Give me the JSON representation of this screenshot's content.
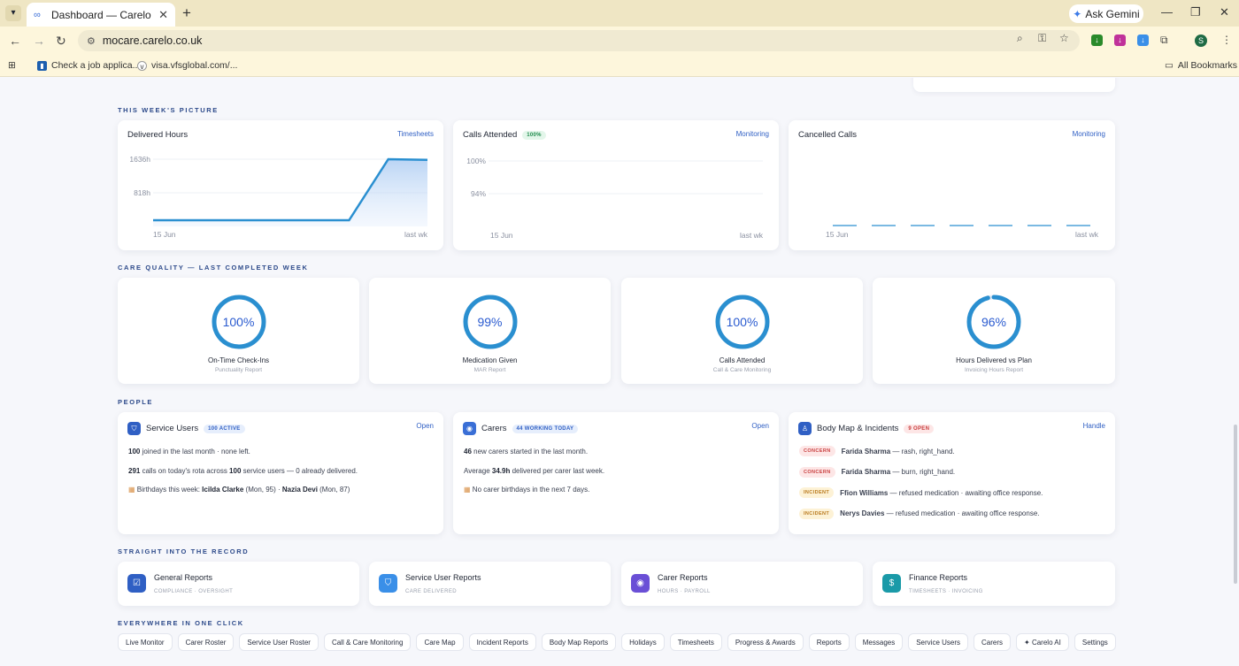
{
  "browser": {
    "tab_title": "Dashboard — Carelo",
    "url": "mocare.carelo.co.uk",
    "ask_gemini": "Ask Gemini",
    "profile_initial": "S",
    "bookmarks": [
      "Check a job applica...",
      "visa.vfsglobal.com/..."
    ],
    "all_bookmarks": "All Bookmarks"
  },
  "sections": {
    "week": "THIS WEEK'S PICTURE",
    "quality": "CARE QUALITY — LAST COMPLETED WEEK",
    "people": "PEOPLE",
    "record": "STRAIGHT INTO THE RECORD",
    "everywhere": "EVERYWHERE IN ONE CLICK"
  },
  "week_cards": {
    "delivered": {
      "title": "Delivered Hours",
      "link": "Timesheets"
    },
    "calls": {
      "title": "Calls Attended",
      "badge": "100%",
      "link": "Monitoring"
    },
    "cancelled": {
      "title": "Cancelled Calls",
      "link": "Monitoring"
    }
  },
  "chart_data": [
    {
      "type": "area",
      "title": "Delivered Hours",
      "y_ticks": [
        "1636h",
        "818h"
      ],
      "x_ticks": [
        "15 Jun",
        "last wk"
      ],
      "ylim": [
        0,
        1636
      ],
      "values": [
        150,
        150,
        150,
        150,
        150,
        150,
        1636,
        1620
      ],
      "color": "#2a8fd0"
    },
    {
      "type": "line",
      "title": "Calls Attended",
      "y_ticks": [
        "100%",
        "94%"
      ],
      "x_ticks": [
        "15 Jun",
        "last wk"
      ],
      "ylim": [
        88,
        100
      ],
      "values": [],
      "color": "#2a8fd0"
    },
    {
      "type": "bar",
      "title": "Cancelled Calls",
      "x_ticks": [
        "15 Jun",
        "last wk"
      ],
      "values": [
        0,
        0,
        0,
        0,
        0,
        0,
        0
      ],
      "color": "#2a8fd0"
    }
  ],
  "quality": [
    {
      "value": 100,
      "text": "100%",
      "label": "On-Time Check-Ins",
      "sub": "Punctuality Report"
    },
    {
      "value": 99,
      "text": "99%",
      "label": "Medication Given",
      "sub": "MAR Report"
    },
    {
      "value": 100,
      "text": "100%",
      "label": "Calls Attended",
      "sub": "Call & Care Monitoring"
    },
    {
      "value": 96,
      "text": "96%",
      "label": "Hours Delivered vs Plan",
      "sub": "Invoicing Hours Report"
    }
  ],
  "people": {
    "service_users": {
      "title": "Service Users",
      "badge": "100 ACTIVE",
      "link": "Open",
      "l1_num": "100",
      "l1_rest": " joined in the last month · none left.",
      "l2_num": "291",
      "l2_mid": " calls on today's rota across ",
      "l2_num2": "100",
      "l2_rest": " service users — 0 already delivered.",
      "l3_pre": "Birthdays this week: ",
      "l3_n1": "Icilda Clarke",
      "l3_m1": " (Mon, 95) · ",
      "l3_n2": "Nazia Devi",
      "l3_m2": " (Mon, 87)"
    },
    "carers": {
      "title": "Carers",
      "badge": "44 WORKING TODAY",
      "link": "Open",
      "l1_num": "46",
      "l1_rest": " new carers started in the last month.",
      "l2_pre": "Average ",
      "l2_num": "34.9h",
      "l2_rest": " delivered per carer last week.",
      "l3": "No carer birthdays in the next 7 days."
    },
    "body_map": {
      "title": "Body Map & Incidents",
      "badge": "9 OPEN",
      "link": "Handle",
      "items": [
        {
          "tag": "CONCERN",
          "name": "Farida Sharma",
          "text": " — rash, right_hand."
        },
        {
          "tag": "CONCERN",
          "name": "Farida Sharma",
          "text": " — burn, right_hand."
        },
        {
          "tag": "INCIDENT",
          "name": "Ffion Williams",
          "text": " — refused medication · awaiting office response."
        },
        {
          "tag": "INCIDENT",
          "name": "Nerys Davies",
          "text": " — refused medication · awaiting office response."
        }
      ]
    }
  },
  "reports": [
    {
      "title": "General Reports",
      "sub": "COMPLIANCE · OVERSIGHT",
      "color": "#2f5fc4",
      "icon": "clipboard-icon"
    },
    {
      "title": "Service User Reports",
      "sub": "CARE DELIVERED",
      "color": "#3a8fe8",
      "icon": "shield-icon"
    },
    {
      "title": "Carer Reports",
      "sub": "HOURS · PAYROLL",
      "color": "#6a4fd6",
      "icon": "user-icon"
    },
    {
      "title": "Finance Reports",
      "sub": "TIMESHEETS · INVOICING",
      "color": "#1a9aa8",
      "icon": "dollar-icon"
    }
  ],
  "chips": [
    "Live Monitor",
    "Carer Roster",
    "Service User Roster",
    "Call & Care Monitoring",
    "Care Map",
    "Incident Reports",
    "Body Map Reports",
    "Holidays",
    "Timesheets",
    "Progress & Awards",
    "Reports",
    "Messages",
    "Service Users",
    "Carers",
    "✦ Carelo AI",
    "Settings"
  ]
}
